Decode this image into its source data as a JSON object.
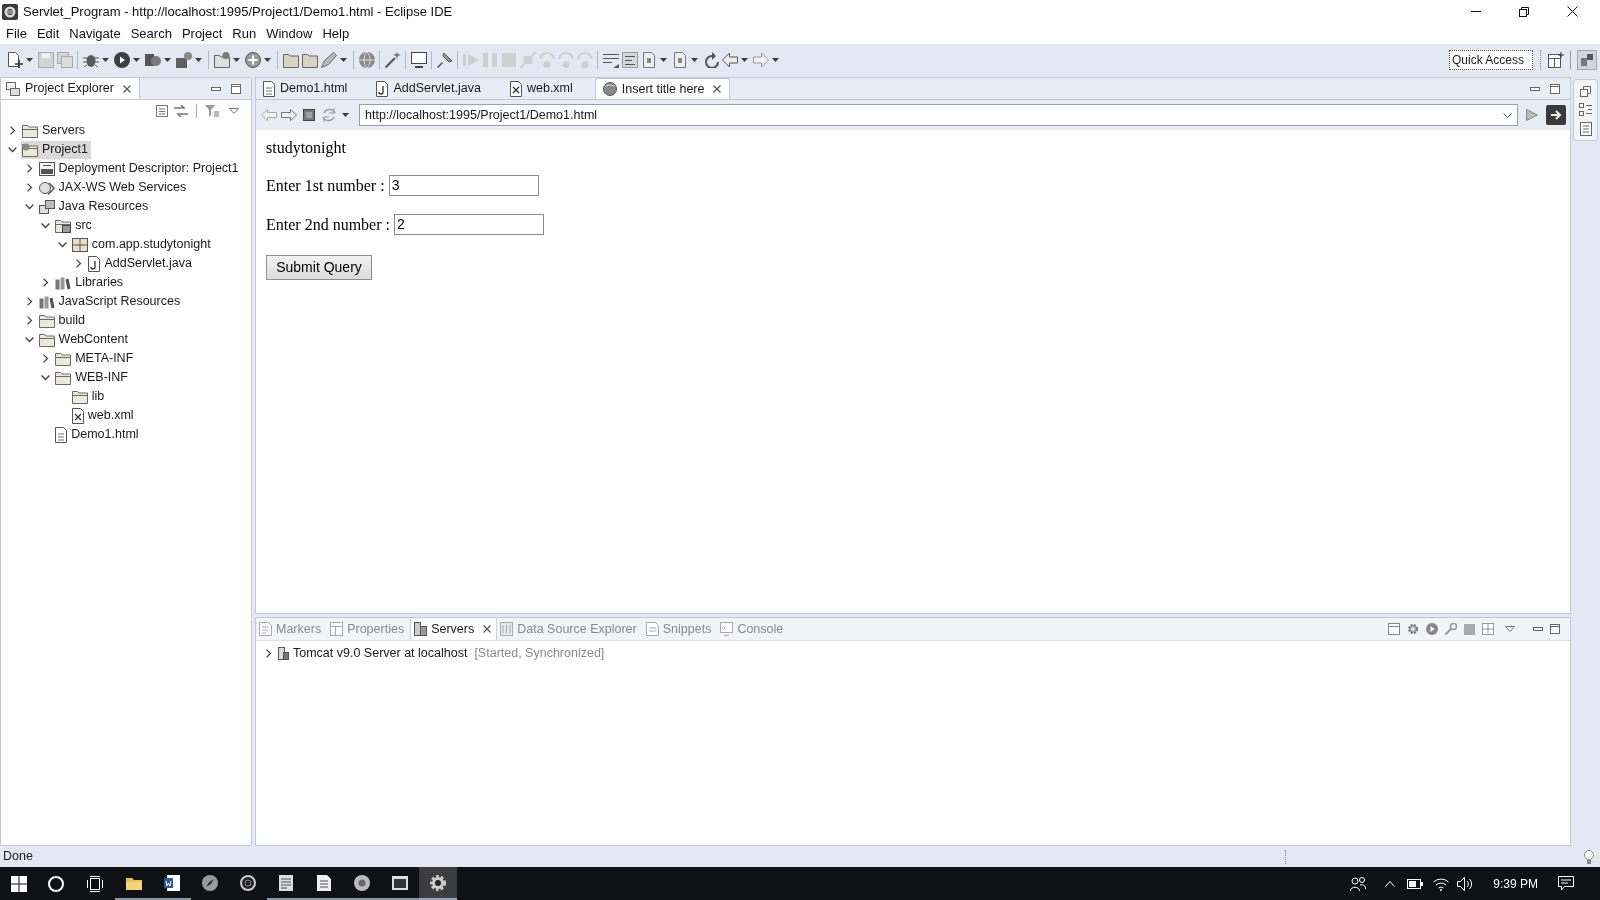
{
  "window": {
    "title": "Servlet_Program - http://localhost:1995/Project1/Demo1.html - Eclipse IDE"
  },
  "menu": [
    "File",
    "Edit",
    "Navigate",
    "Search",
    "Project",
    "Run",
    "Window",
    "Help"
  ],
  "quick_access": {
    "placeholder": "Quick Access"
  },
  "project_explorer": {
    "title": "Project Explorer",
    "tree": [
      {
        "label": "Servers",
        "kind": "folder",
        "expandable": true,
        "expanded": false,
        "selected": false
      },
      {
        "label": "Project1",
        "kind": "project",
        "expandable": true,
        "expanded": true,
        "selected": true,
        "children": [
          {
            "label": "Deployment Descriptor: Project1",
            "kind": "descriptor",
            "expandable": true,
            "expanded": false,
            "selected": false
          },
          {
            "label": "JAX-WS Web Services",
            "kind": "services",
            "expandable": true,
            "expanded": false,
            "selected": false
          },
          {
            "label": "Java Resources",
            "kind": "resources",
            "expandable": true,
            "expanded": true,
            "selected": false,
            "children": [
              {
                "label": "src",
                "kind": "source",
                "expandable": true,
                "expanded": true,
                "selected": false,
                "children": [
                  {
                    "label": "com.app.studytonight",
                    "kind": "package",
                    "expandable": true,
                    "expanded": true,
                    "selected": false,
                    "children": [
                      {
                        "label": "AddServlet.java",
                        "kind": "java",
                        "expandable": true,
                        "expanded": false,
                        "selected": false
                      }
                    ]
                  }
                ]
              },
              {
                "label": "Libraries",
                "kind": "library",
                "expandable": true,
                "expanded": false,
                "selected": false
              }
            ]
          },
          {
            "label": "JavaScript Resources",
            "kind": "library",
            "expandable": true,
            "expanded": false,
            "selected": false
          },
          {
            "label": "build",
            "kind": "folder",
            "expandable": true,
            "expanded": false,
            "selected": false
          },
          {
            "label": "WebContent",
            "kind": "folder",
            "expandable": true,
            "expanded": true,
            "selected": false,
            "children": [
              {
                "label": "META-INF",
                "kind": "folder",
                "expandable": true,
                "expanded": false,
                "selected": false
              },
              {
                "label": "WEB-INF",
                "kind": "folder",
                "expandable": true,
                "expanded": true,
                "selected": false,
                "children": [
                  {
                    "label": "lib",
                    "kind": "folder",
                    "expandable": false,
                    "selected": false
                  },
                  {
                    "label": "web.xml",
                    "kind": "xml",
                    "expandable": false,
                    "selected": false
                  }
                ]
              },
              {
                "label": "Demo1.html",
                "kind": "html",
                "expandable": false,
                "selected": false
              }
            ]
          }
        ]
      }
    ]
  },
  "editor_tabs": [
    {
      "label": "Demo1.html",
      "kind": "html",
      "selected": false
    },
    {
      "label": "AddServlet.java",
      "kind": "java",
      "selected": false
    },
    {
      "label": "web.xml",
      "kind": "xml",
      "selected": false
    },
    {
      "label": "Insert title here",
      "kind": "browser",
      "selected": true
    }
  ],
  "browser": {
    "url": "http://localhost:1995/Project1/Demo1.html",
    "heading": "studytonight",
    "fields": [
      {
        "label": "Enter 1st number :",
        "value": "3"
      },
      {
        "label": "Enter 2nd number :",
        "value": "2"
      }
    ],
    "submit": "Submit Query"
  },
  "bottom_panel": {
    "tabs": [
      {
        "label": "Markers",
        "kind": "markers",
        "selected": false
      },
      {
        "label": "Properties",
        "kind": "properties",
        "selected": false
      },
      {
        "label": "Servers",
        "kind": "servers",
        "selected": true
      },
      {
        "label": "Data Source Explorer",
        "kind": "datasource",
        "selected": false
      },
      {
        "label": "Snippets",
        "kind": "snippets",
        "selected": false
      },
      {
        "label": "Console",
        "kind": "console",
        "selected": false
      }
    ],
    "servers": [
      {
        "name": "Tomcat v9.0 Server at localhost",
        "status": "[Started, Synchronized]",
        "expanded": false
      }
    ]
  },
  "status_bar": {
    "text": "Done"
  },
  "taskbar": {
    "time": "9:39 PM"
  }
}
